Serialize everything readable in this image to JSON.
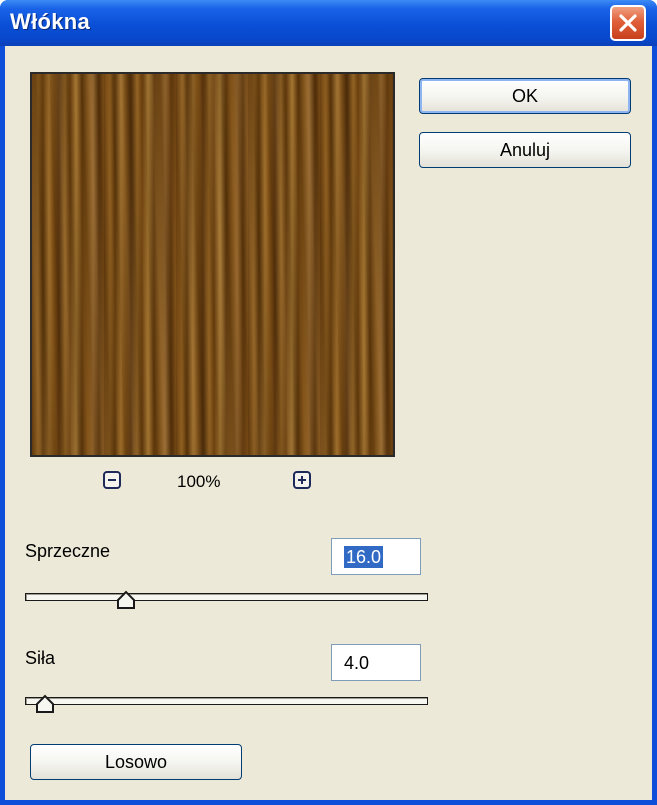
{
  "window": {
    "title": "Włókna"
  },
  "buttons": {
    "ok": "OK",
    "cancel": "Anuluj",
    "random": "Losowo"
  },
  "zoom": {
    "value": "100%"
  },
  "sliders": [
    {
      "label": "Sprzeczne",
      "value": "16.0",
      "selected": true,
      "level": 0.24
    },
    {
      "label": "Siła",
      "value": "4.0",
      "selected": false,
      "level": 0.04
    }
  ],
  "icons": {
    "close": "close-icon",
    "zoom_out": "minus-icon",
    "zoom_in": "plus-icon"
  },
  "colors": {
    "titlebar": "#0a4fd6",
    "client_bg": "#ece9d8",
    "selection": "#316ac5",
    "close_button": "#e0603a"
  }
}
